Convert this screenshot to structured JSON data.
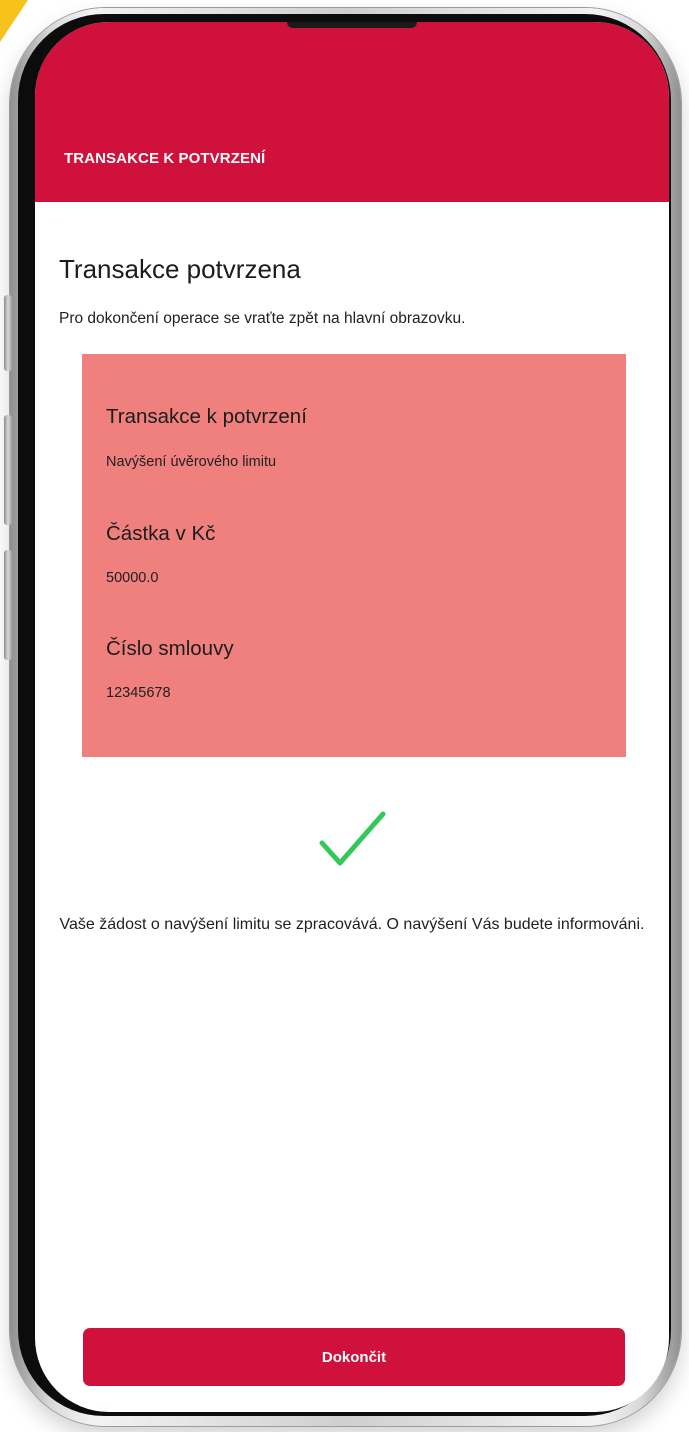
{
  "header": {
    "title": "TRANSAKCE K POTVRZENÍ"
  },
  "main": {
    "title": "Transakce potvrzena",
    "subtitle": "Pro dokončení operace se vraťte zpět na hlavní obrazovku."
  },
  "card": {
    "rows": [
      {
        "label": "Transakce k potvrzení",
        "value": "Navýšení úvěrového limitu"
      },
      {
        "label": "Částka v Kč",
        "value": "50000.0"
      },
      {
        "label": "Číslo smlouvy",
        "value": "12345678"
      }
    ]
  },
  "status": {
    "icon": "check-icon",
    "message": "Vaše žádost o navýšení limitu se zpracovává. O navýšení Vás budete informováni."
  },
  "actions": {
    "finish_label": "Dokončit"
  },
  "colors": {
    "brand": "#cf113b",
    "card_background": "#ef807e",
    "success": "#34c759"
  }
}
